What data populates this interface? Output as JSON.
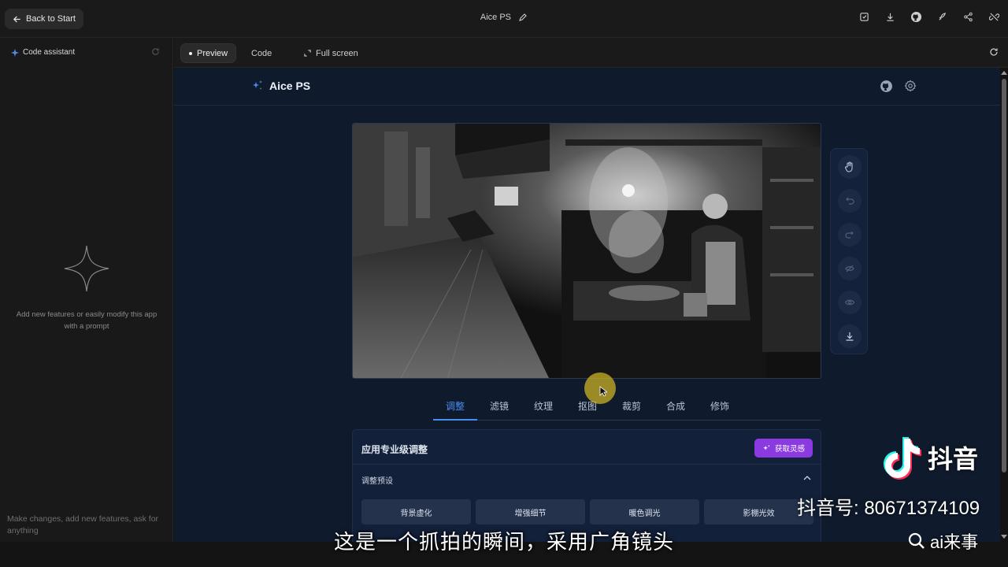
{
  "topbar": {
    "back_label": "Back to Start",
    "project_title": "Aice PS",
    "icons": [
      "save-icon",
      "download-icon",
      "github-icon",
      "rocket-icon",
      "share-icon",
      "link-off-icon"
    ]
  },
  "sidebar": {
    "title": "Code assistant",
    "empty_text": "Add new features or easily modify this app with a prompt",
    "prompt_placeholder": "Make changes, add new features, ask for anything"
  },
  "tabs": {
    "preview": "Preview",
    "code": "Code",
    "fullscreen": "Full screen"
  },
  "app": {
    "brand": "Aice PS",
    "header_icons": [
      "github-icon",
      "settings-icon"
    ],
    "toolrail": [
      "pan-hand-icon",
      "undo-icon",
      "redo-icon",
      "compare-icon",
      "eye-icon",
      "download-icon"
    ],
    "subtabs": [
      "调整",
      "滤镜",
      "纹理",
      "抠图",
      "裁剪",
      "合成",
      "修饰"
    ],
    "active_subtab": "调整",
    "panel": {
      "title": "应用专业级调整",
      "inspire_button": "获取灵感",
      "section_title": "调整预设",
      "presets": [
        "背景虚化",
        "增强细节",
        "暖色调光",
        "影棚光效"
      ]
    }
  },
  "overlay": {
    "subtitle": "这是一个抓拍的瞬间，采用广角镜头",
    "douyin_name": "抖音",
    "douyin_id": "抖音号: 80671374109",
    "search_text": "ai来事"
  },
  "colors": {
    "accent_blue": "#4a8cf0",
    "inspire_purple": "#8a3ae0",
    "app_bg": "#0f1b2d"
  }
}
